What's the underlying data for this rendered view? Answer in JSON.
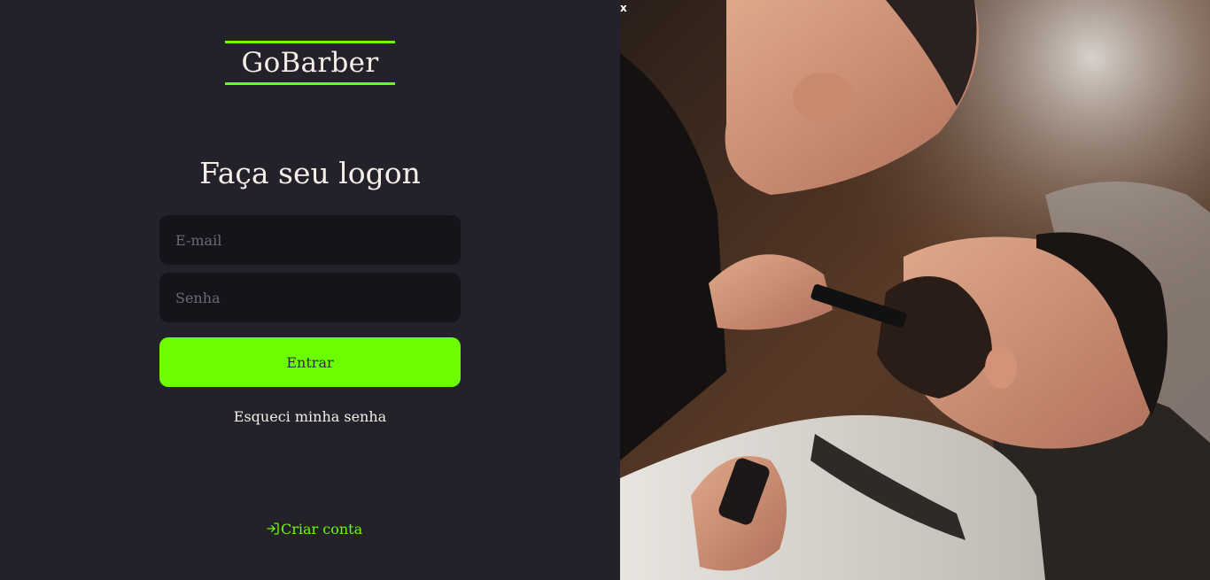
{
  "brand": {
    "logo_text": "GoBarber",
    "accent_color": "#6cfd00",
    "background_color": "#232129",
    "input_background": "#16141b"
  },
  "login": {
    "title": "Faça seu logon",
    "email_placeholder": "E-mail",
    "password_placeholder": "Senha",
    "submit_label": "Entrar",
    "forgot_label": "Esqueci minha senha",
    "create_account_label": "Criar conta",
    "create_account_icon": "log-in-icon"
  },
  "hero": {
    "close_label": "x",
    "image_subject": "barbershop-photo"
  }
}
